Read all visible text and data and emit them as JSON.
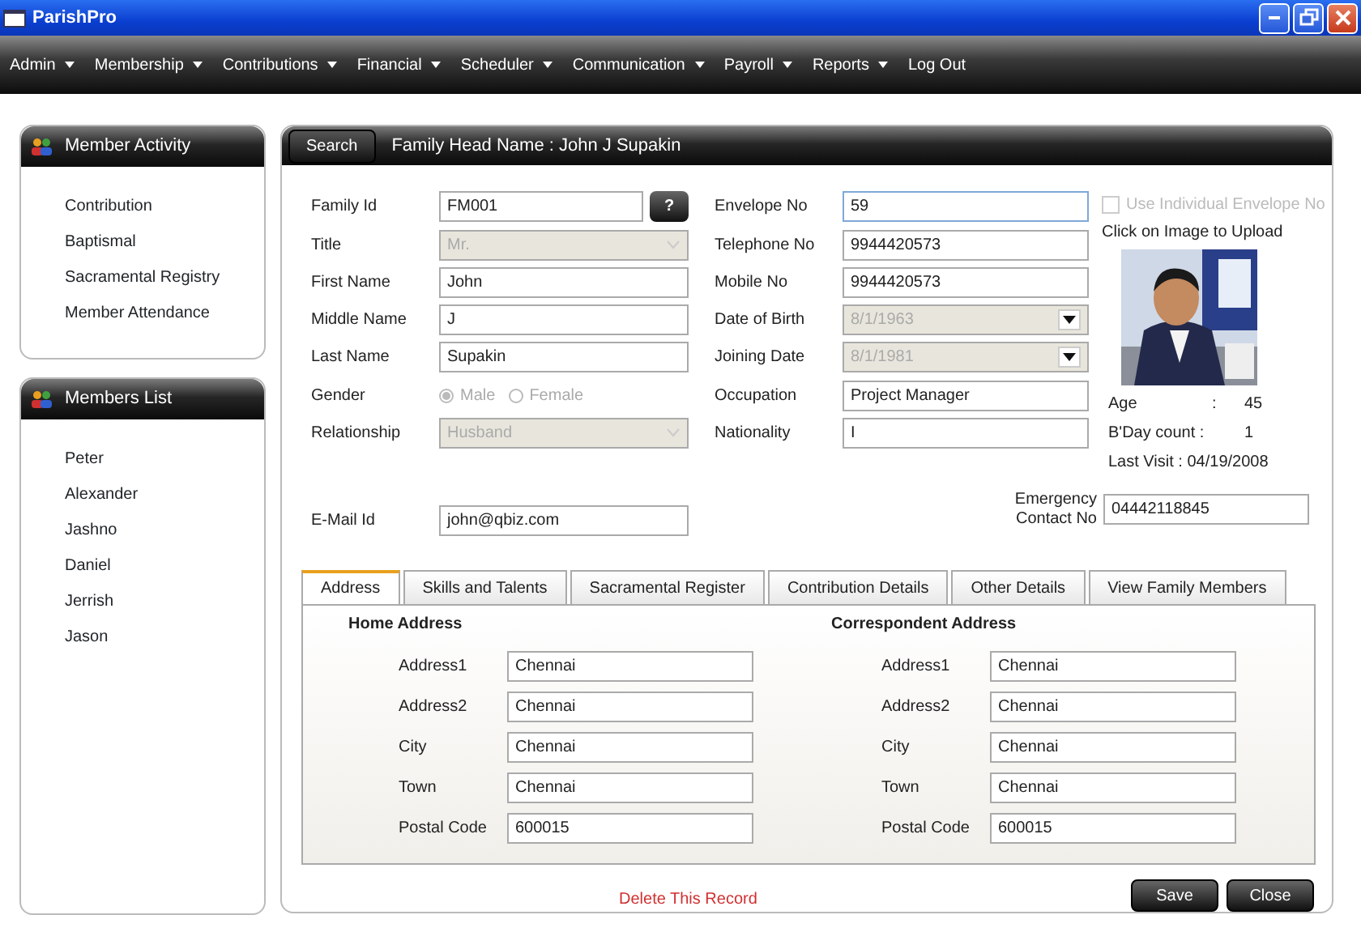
{
  "window": {
    "title": "ParishPro"
  },
  "menu": [
    {
      "label": "Admin",
      "dropdown": true
    },
    {
      "label": "Membership",
      "dropdown": true
    },
    {
      "label": "Contributions",
      "dropdown": true
    },
    {
      "label": "Financial",
      "dropdown": true
    },
    {
      "label": "Scheduler",
      "dropdown": true
    },
    {
      "label": "Communication",
      "dropdown": true
    },
    {
      "label": "Payroll",
      "dropdown": true
    },
    {
      "label": "Reports",
      "dropdown": true
    },
    {
      "label": "Log Out",
      "dropdown": false
    }
  ],
  "sidebar": [
    {
      "title": "Member Activity",
      "items": [
        "Contribution",
        "Baptismal",
        "Sacramental Registry",
        "Member Attendance"
      ]
    },
    {
      "title": "Members List",
      "items": [
        "Peter",
        "Alexander",
        "Jashno",
        "Daniel",
        "Jerrish",
        "Jason"
      ]
    }
  ],
  "header": {
    "search_button": "Search",
    "title": "Family Head Name : John J Supakin"
  },
  "left_fields": [
    {
      "label": "Family Id",
      "kind": "text",
      "value": "FM001",
      "button": "?"
    },
    {
      "label": "Title",
      "kind": "select",
      "value": "Mr.",
      "disabled": true
    },
    {
      "label": "First Name",
      "kind": "text",
      "value": "John"
    },
    {
      "label": "Middle Name",
      "kind": "text",
      "value": "J"
    },
    {
      "label": "Last Name",
      "kind": "text",
      "value": "Supakin"
    },
    {
      "label": "Gender",
      "kind": "radio",
      "disabled": true,
      "options": [
        {
          "label": "Male",
          "selected": true
        },
        {
          "label": "Female",
          "selected": false
        }
      ]
    },
    {
      "label": "Relationship",
      "kind": "select",
      "value": "Husband",
      "disabled": true
    }
  ],
  "middle_fields": [
    {
      "label": "Envelope No",
      "kind": "text",
      "value": "59",
      "focused": true
    },
    {
      "label": "Telephone No",
      "kind": "text",
      "value": "9944420573"
    },
    {
      "label": "Mobile No",
      "kind": "text",
      "value": "9944420573"
    },
    {
      "label": "Date of Birth",
      "kind": "date",
      "value": "8/1/1963",
      "disabled": true
    },
    {
      "label": "Joining Date",
      "kind": "date",
      "value": "8/1/1981",
      "disabled": true
    },
    {
      "label": "Occupation",
      "kind": "text",
      "value": "Project Manager"
    },
    {
      "label": "Nationality",
      "kind": "text",
      "value": "I"
    }
  ],
  "envelope_checkbox": {
    "label": "Use Individual Envelope No",
    "checked": false,
    "disabled": true
  },
  "photo": {
    "caption": "Click on Image to Upload",
    "kind": "picture"
  },
  "stats": [
    {
      "label": "Age",
      "sep": ":",
      "value": "45"
    },
    {
      "label": "B'Day count :",
      "value": "1"
    },
    {
      "label": "Last Visit : 04/19/2008"
    }
  ],
  "email": {
    "label": "E-Mail Id",
    "value": "john@qbiz.com"
  },
  "emergency": {
    "label": "Emergency Contact No",
    "value": "04442118845"
  },
  "tabs": [
    {
      "label": "Address",
      "selected": true
    },
    {
      "label": "Skills and Talents",
      "selected": false
    },
    {
      "label": "Sacramental Register",
      "selected": false
    },
    {
      "label": "Contribution Details",
      "selected": false
    },
    {
      "label": "Other Details",
      "selected": false
    },
    {
      "label": "View Family Members",
      "selected": false
    }
  ],
  "addresses": [
    {
      "title": "Home Address",
      "fields": [
        {
          "label": "Address1",
          "value": "Chennai"
        },
        {
          "label": "Address2",
          "value": "Chennai"
        },
        {
          "label": "City",
          "value": "Chennai"
        },
        {
          "label": "Town",
          "value": "Chennai"
        },
        {
          "label": "Postal Code",
          "value": "600015"
        }
      ]
    },
    {
      "title": "Correspondent Address",
      "fields": [
        {
          "label": "Address1",
          "value": "Chennai"
        },
        {
          "label": "Address2",
          "value": "Chennai"
        },
        {
          "label": "City",
          "value": "Chennai"
        },
        {
          "label": "Town",
          "value": "Chennai"
        },
        {
          "label": "Postal Code",
          "value": "600015"
        }
      ]
    }
  ],
  "delete_link": "Delete This Record",
  "buttons": [
    "Save",
    "Close"
  ]
}
